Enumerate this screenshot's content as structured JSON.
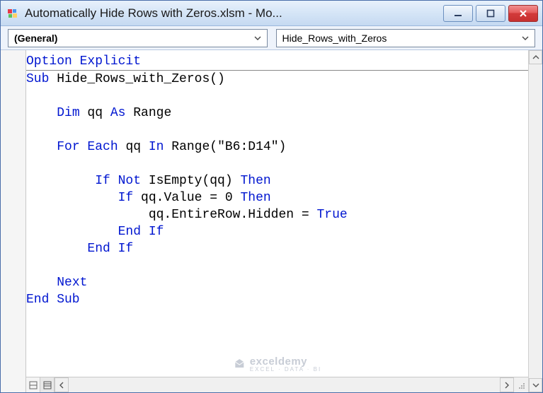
{
  "window": {
    "title": "Automatically Hide Rows with Zeros.xlsm - Mo..."
  },
  "dropdowns": {
    "object": "(General)",
    "procedure": "Hide_Rows_with_Zeros"
  },
  "code": {
    "line1": "Option Explicit",
    "sub_kw": "Sub",
    "sub_name": " Hide_Rows_with_Zeros()",
    "dim_kw": "Dim",
    "dim_mid": " qq ",
    "as_kw": "As",
    "dim_type": " Range",
    "for_kw": "For Each",
    "for_mid": " qq ",
    "in_kw": "In",
    "for_range": " Range(\"B6:D14\")",
    "if1_kw": "If Not",
    "if1_mid": " IsEmpty(qq) ",
    "then_kw": "Then",
    "if2_kw": "If",
    "if2_mid": " qq.Value = 0 ",
    "assign": "qq.EntireRow.Hidden = ",
    "true_kw": "True",
    "endif_kw": "End If",
    "next_kw": "Next",
    "endsub_kw": "End Sub"
  },
  "watermark": {
    "brand": "exceldemy",
    "tag": "EXCEL · DATA · BI"
  }
}
